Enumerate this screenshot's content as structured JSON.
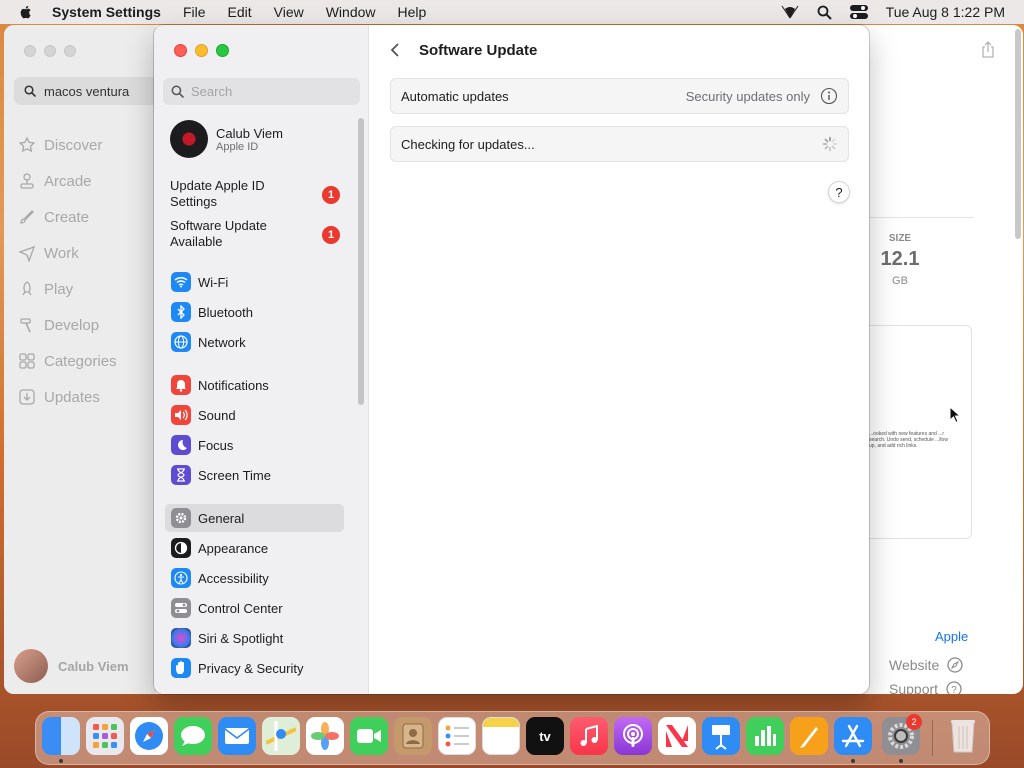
{
  "menubar": {
    "app_name": "System Settings",
    "menus": [
      "File",
      "Edit",
      "View",
      "Window",
      "Help"
    ],
    "clock": "Tue Aug 8  1:22 PM"
  },
  "appstore": {
    "search_value": "macos ventura",
    "nav": [
      "Discover",
      "Arcade",
      "Create",
      "Work",
      "Play",
      "Develop",
      "Categories",
      "Updates"
    ],
    "user_name": "Calub Viem",
    "size_label": "SIZE",
    "size_value": "12.1",
    "size_unit": "GB",
    "card_text": "...ooked with new features and ...r search. Undo send, schedule ...llow up, and add rich links.",
    "developer": "Apple",
    "links": [
      "Website",
      "Support"
    ]
  },
  "settings": {
    "search_placeholder": "Search",
    "account": {
      "name": "Calub Viem",
      "subtitle": "Apple ID"
    },
    "notices": [
      {
        "label": "Update Apple ID Settings",
        "badge": "1"
      },
      {
        "label": "Software Update Available",
        "badge": "1"
      }
    ],
    "groups": [
      [
        "Wi-Fi",
        "Bluetooth",
        "Network"
      ],
      [
        "Notifications",
        "Sound",
        "Focus",
        "Screen Time"
      ],
      [
        "General",
        "Appearance",
        "Accessibility",
        "Control Center",
        "Siri & Spotlight",
        "Privacy & Security"
      ]
    ],
    "selected": "General",
    "page_title": "Software Update",
    "auto_updates_label": "Automatic updates",
    "auto_updates_value": "Security updates only",
    "checking_label": "Checking for updates...",
    "help_label": "?"
  },
  "dock": {
    "apps": [
      "Finder",
      "Launchpad",
      "Safari",
      "Messages",
      "Mail",
      "Maps",
      "Photos",
      "FaceTime",
      "Contacts",
      "Reminders",
      "Notes",
      "TV",
      "Music",
      "Podcasts",
      "News",
      "Keynote",
      "Numbers",
      "Pages",
      "App Store",
      "System Settings",
      "Trash"
    ],
    "settings_badge": "2",
    "tv_label": "tv"
  },
  "colors": {
    "accent": "#007aff",
    "badge": "#ea3a2f"
  }
}
